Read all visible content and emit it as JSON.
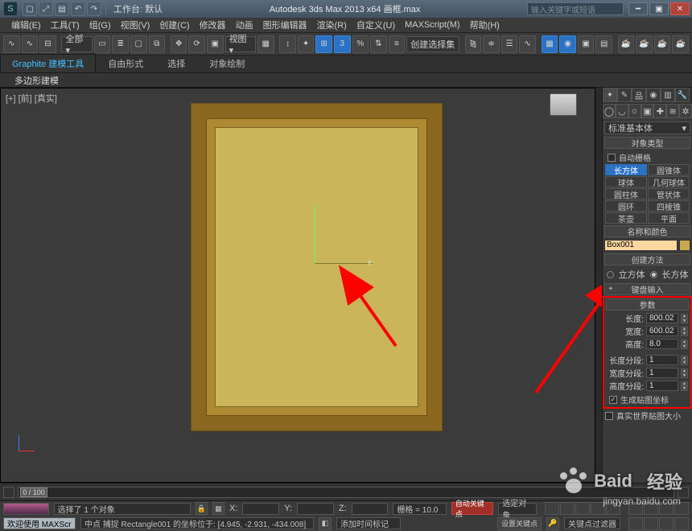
{
  "title": "Autodesk 3ds Max  2013 x64   画框.max",
  "workspace_label": "工作台: 默认",
  "search_placeholder": "输入关键字或短语",
  "menubar": [
    "编辑(E)",
    "工具(T)",
    "组(G)",
    "视图(V)",
    "创建(C)",
    "修改器",
    "动画",
    "图形编辑器",
    "渲染(R)",
    "自定义(U)",
    "MAXScript(M)",
    "帮助(H)"
  ],
  "ribbon_tabs": [
    "Graphite 建模工具",
    "自由形式",
    "选择",
    "对象绘制"
  ],
  "ribbon_active_sub": "多边形建模",
  "viewport_label": "[+] [前] [真实]",
  "toolbar": {
    "selset_combo": "全部 ▾",
    "view_combo": "视图 ▾",
    "create_combo": "创建选择集"
  },
  "cmdpanel": {
    "dropdown": "标准基本体",
    "rollouts": {
      "object_type": "对象类型",
      "auto_grid": "自动栅格",
      "name_color": "名称和颜色",
      "creation_method": "创建方法",
      "keyboard_entry": "键盘输入",
      "parameters": "参数"
    },
    "primitives": [
      [
        "长方体",
        "圆锥体"
      ],
      [
        "球体",
        "几何球体"
      ],
      [
        "圆柱体",
        "管状体"
      ],
      [
        "圆环",
        "四棱锥"
      ],
      [
        "茶壶",
        "平面"
      ]
    ],
    "object_name": "Box001",
    "creation_radios": {
      "cube": "立方体",
      "box": "长方体"
    },
    "params": {
      "length_label": "长度:",
      "length_value": "800.02",
      "width_label": "宽度:",
      "width_value": "600.02",
      "height_label": "高度:",
      "height_value": "8.0",
      "lseg_label": "长度分段:",
      "lseg_value": "1",
      "wseg_label": "宽度分段:",
      "wseg_value": "1",
      "hseg_label": "高度分段:",
      "hseg_value": "1",
      "gen_map": "生成贴图坐标",
      "real_world": "真实世界贴图大小"
    }
  },
  "timeline": {
    "frame": "0 / 100"
  },
  "status": {
    "selected": "选择了 1 个对象",
    "welcome": "欢迎使用  MAXScr",
    "hint": "中点 捕捉 Rectangle001 的坐标位于: [4.945, -2.931, -434.008]",
    "add_time_tag": "添加时间标记",
    "grid": "栅格 = 10.0",
    "autokey": "自动关键点",
    "setkey": "设置关键点",
    "selset_button": "选定对象",
    "key_filter": "关键点过滤器",
    "x": "X:",
    "y": "Y:",
    "z": "Z:"
  },
  "watermark": {
    "brand": "Baid",
    "brand2": "经验",
    "url": "jingyan.baidu.com"
  }
}
